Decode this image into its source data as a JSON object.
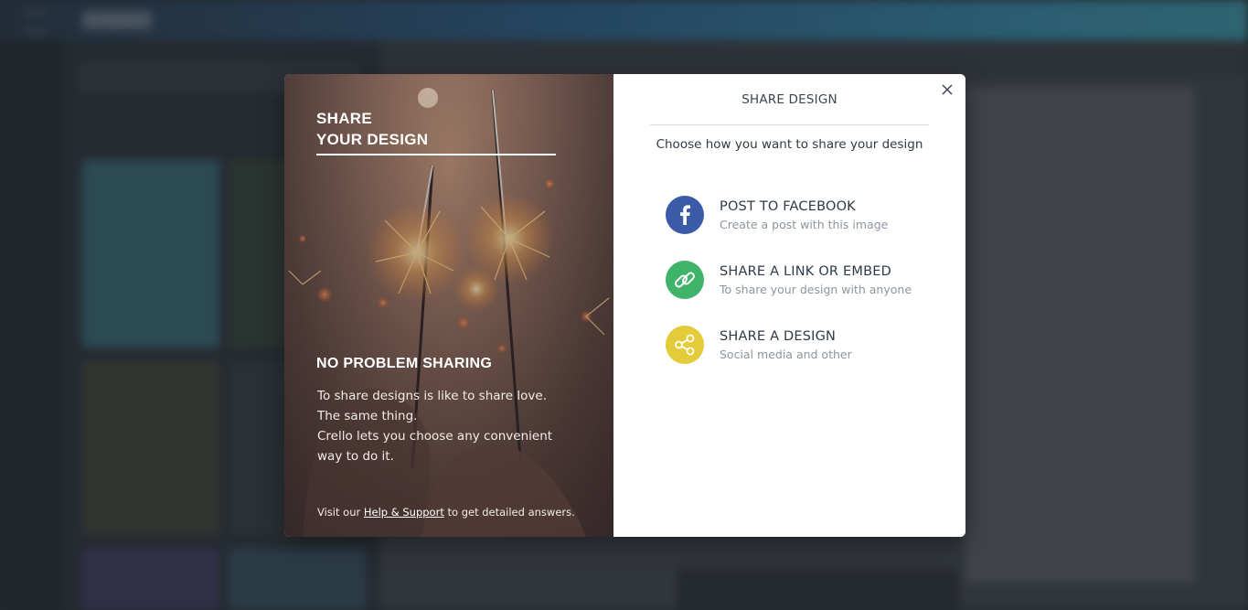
{
  "modal": {
    "promo": {
      "title_line1": "SHARE",
      "title_line2": "YOUR DESIGN",
      "heading": "NO PROBLEM SHARING",
      "body_line1": "To share designs is like to share love.",
      "body_line2": "The same thing.",
      "body_line3": "Crello lets you choose any convenient",
      "body_line4": "way to do it.",
      "footer_prefix": "Visit our",
      "footer_link": "Help & Support",
      "footer_suffix": "to get detailed answers."
    },
    "panel": {
      "title": "SHARE DESIGN",
      "subtitle": "Choose how you want to share your design",
      "close_icon": "close-icon",
      "options": [
        {
          "label": "POST TO FACEBOOK",
          "description": "Create a post with this image",
          "icon": "facebook-icon",
          "color": "#3b5ba8"
        },
        {
          "label": "SHARE A LINK OR EMBED",
          "description": "To share your design with anyone",
          "icon": "link-icon",
          "color": "#3fb36a"
        },
        {
          "label": "SHARE A DESIGN",
          "description": "Social media and other",
          "icon": "share-icon",
          "color": "#e3cb3a"
        }
      ]
    }
  }
}
